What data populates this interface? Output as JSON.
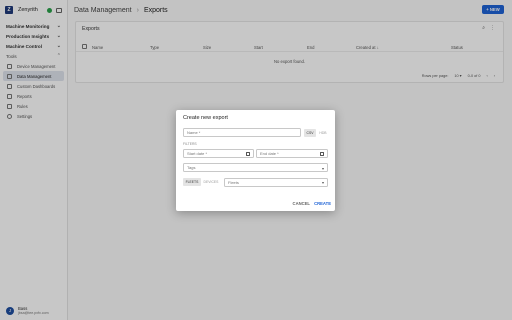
{
  "sidebar": {
    "brand": {
      "logo": "Z",
      "name": "Zenyrith"
    },
    "sections": [
      {
        "label": "Machine Monitoring"
      },
      {
        "label": "Production Insights"
      },
      {
        "label": "Machine Control"
      },
      {
        "label": "Tools"
      }
    ],
    "tools_items": [
      {
        "label": "Device Management",
        "icon": "device-icon"
      },
      {
        "label": "Data Management",
        "icon": "database-icon",
        "active": true
      },
      {
        "label": "Custom Dashboards",
        "icon": "dashboard-icon"
      },
      {
        "label": "Reports",
        "icon": "report-icon"
      },
      {
        "label": "Rules",
        "icon": "rules-icon"
      },
      {
        "label": "Settings",
        "icon": "gear-icon"
      }
    ],
    "user": {
      "initial": "J",
      "name": "Bass",
      "email": "jbsa@tee.pxfx.com"
    }
  },
  "header": {
    "breadcrumb_parent": "Data Management",
    "breadcrumb_current": "Exports",
    "new_button": "+ NEW"
  },
  "exports_card": {
    "title": "Exports",
    "columns": [
      "Name",
      "Type",
      "Size",
      "Start",
      "End",
      "Created at ↓",
      "Status"
    ],
    "empty_text": "No export found.",
    "rows_per_page_label": "Rows per page:",
    "rows_per_page_value": "10",
    "range_label": "0-0 of 0"
  },
  "dialog": {
    "title": "Create new export",
    "name_placeholder": "Name *",
    "format_options": [
      "CSV",
      "HDB"
    ],
    "filters_label": "FILTERS",
    "start_date_placeholder": "Start date *",
    "end_date_placeholder": "End date *",
    "tags_placeholder": "Tags",
    "match_options": [
      "FLEETS",
      "DEVICES"
    ],
    "fleets_placeholder": "Fleets",
    "cancel_label": "CANCEL",
    "create_label": "CREATE"
  },
  "colors": {
    "accent": "#1e63d6",
    "brand": "#1f3a7a",
    "status_ok": "#2aa14a"
  }
}
